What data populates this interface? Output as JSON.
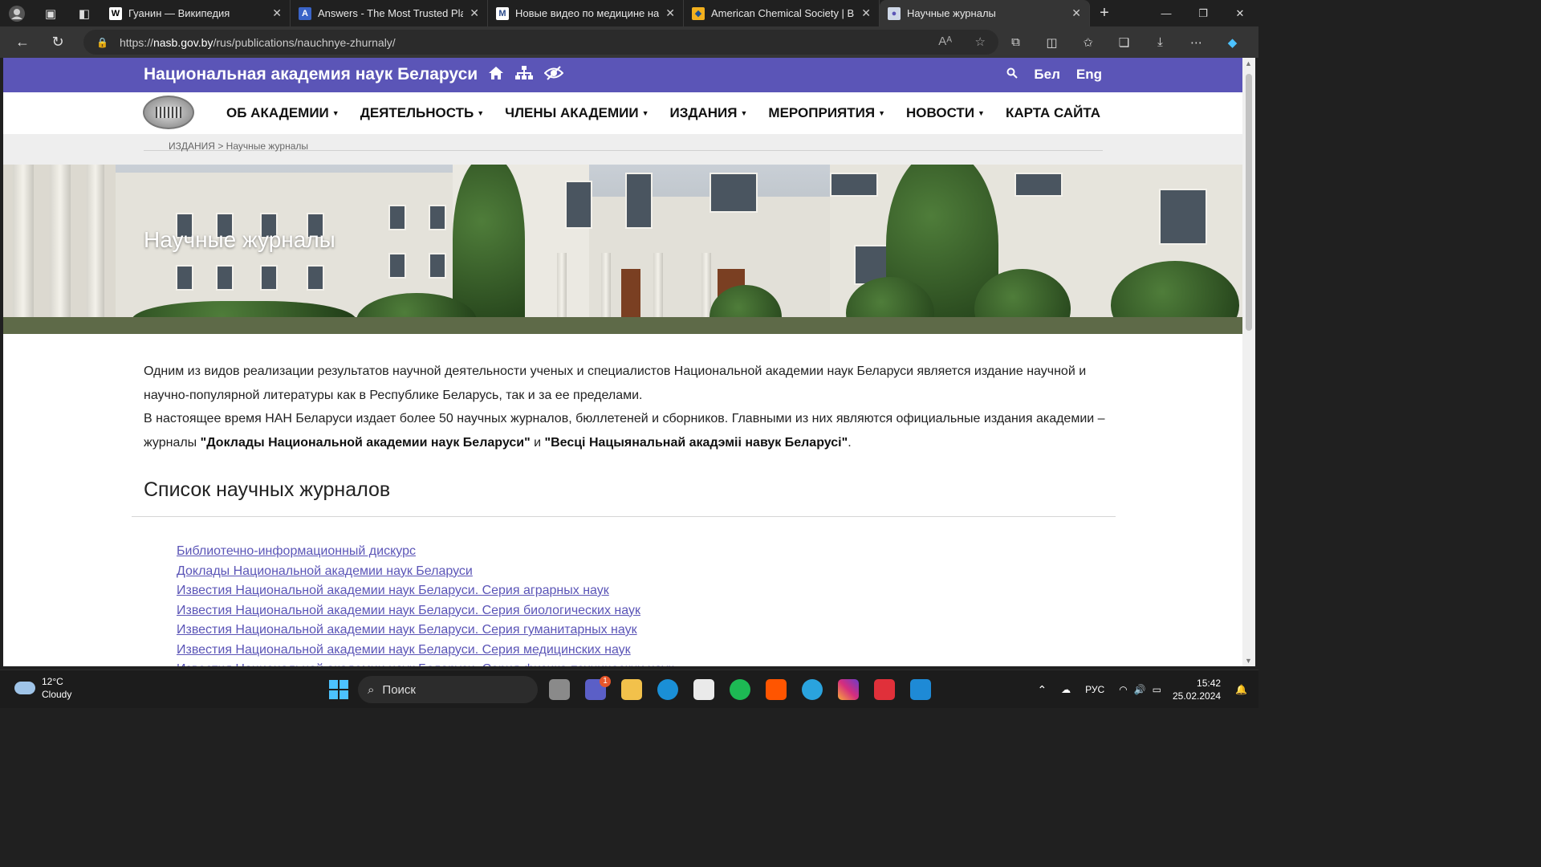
{
  "browser": {
    "tabs": [
      {
        "title": "Гуанин — Википедия",
        "fav_letter": "W",
        "fav_bg": "#ffffff",
        "fav_fg": "#000000"
      },
      {
        "title": "Answers - The Most Trusted Plac",
        "fav_letter": "A",
        "fav_bg": "#3a64c8",
        "fav_fg": "#ffffff"
      },
      {
        "title": "Новые видео по медицине на с",
        "fav_letter": "M",
        "fav_bg": "#ffffff",
        "fav_fg": "#2a4a8a"
      },
      {
        "title": "American Chemical Society | Brow",
        "fav_letter": "◆",
        "fav_bg": "#f2b01e",
        "fav_fg": "#1d4f91"
      },
      {
        "title": "Научные журналы",
        "fav_letter": "●",
        "fav_bg": "#cfd8e8",
        "fav_fg": "#5b55b7"
      }
    ],
    "url_prefix": "https://",
    "url_host": "nasb.gov.by",
    "url_path": "/rus/publications/nauchnye-zhurnaly/"
  },
  "site": {
    "name": "Национальная академия наук Беларуси",
    "lang_be": "Бел",
    "lang_en": "Eng",
    "menu": [
      {
        "label": "ОБ АКАДЕМИИ",
        "caret": true
      },
      {
        "label": "ДЕЯТЕЛЬНОСТЬ",
        "caret": true
      },
      {
        "label": "ЧЛЕНЫ АКАДЕМИИ",
        "caret": true
      },
      {
        "label": "ИЗДАНИЯ",
        "caret": true
      },
      {
        "label": "МЕРОПРИЯТИЯ",
        "caret": true
      },
      {
        "label": "НОВОСТИ",
        "caret": true
      },
      {
        "label": "КАРТА САЙТА",
        "caret": false
      }
    ],
    "breadcrumb_parent": "ИЗДАНИЯ",
    "breadcrumb_sep": ">",
    "breadcrumb_current": "Научные журналы"
  },
  "hero": {
    "title": "Научные журналы"
  },
  "intro": {
    "p1": "Одним из видов реализации результатов научной деятельности ученых и специалистов Национальной академии наук Беларуси является издание научной и научно-популярной литературы как в Республике Беларусь, так и за ее пределами.",
    "p2_start": "В настоящее время НАН Беларуси издает более 50 научных журналов, бюллетеней и сборников. Главными из них являются официальные издания академии – журналы ",
    "p2_bold1": "\"Доклады Национальной академии наук Беларуси\"",
    "p2_mid": " и ",
    "p2_bold2": "\"Весцi Нацыянальнай акадэмii навук Беларусi\"",
    "p2_end": "."
  },
  "list": {
    "title": "Список научных журналов",
    "items": [
      "Библиотечно-информационный дискурс",
      "Доклады Национальной академии наук Беларуси",
      "Известия Национальной академии наук Беларуси. Серия аграрных наук",
      "Известия Национальной академии наук Беларуси. Серия биологических наук",
      "Известия Национальной академии наук Беларуси. Серия гуманитарных наук",
      "Известия Национальной академии наук Беларуси. Серия медицинских наук",
      "Известия Национальной академии наук Беларуси. Серия физико-технических наук"
    ]
  },
  "taskbar": {
    "temp": "12°C",
    "weather": "Cloudy",
    "search_placeholder": "Поиск",
    "lang": "РУС",
    "time": "15:42",
    "date": "25.02.2024",
    "teams_badge": "1"
  }
}
